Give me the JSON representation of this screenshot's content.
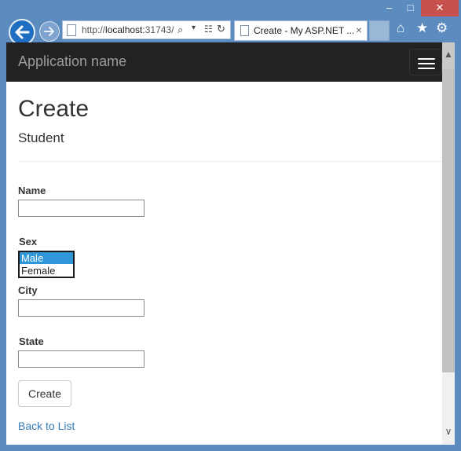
{
  "window": {
    "minimize_glyph": "–",
    "maximize_glyph": "□",
    "close_glyph": "✕"
  },
  "browser": {
    "address_prefix": "http://",
    "address_host": "localhost",
    "address_rest": ":31743/",
    "tab_title": "Create - My ASP.NET ...",
    "tab_close_glyph": "×",
    "icons": [
      "back-arrow-icon",
      "forward-arrow-icon",
      "page-icon",
      "search-icon",
      "dropdown-icon",
      "compatibility-icon",
      "refresh-icon",
      "home-icon",
      "star-icon",
      "gear-icon"
    ]
  },
  "navbar": {
    "brand": "Application name",
    "toggle_icon": "hamburger-icon"
  },
  "page": {
    "title": "Create",
    "subtitle": "Student"
  },
  "form": {
    "name_label": "Name",
    "name_value": "",
    "sex_label": "Sex",
    "sex_options": [
      "Male",
      "Female"
    ],
    "sex_selected": "Male",
    "city_label": "City",
    "city_value": "",
    "state_label": "State",
    "state_value": "",
    "submit_label": "Create",
    "back_link": "Back to List"
  },
  "colors": {
    "navbar_bg": "#222222",
    "link": "#337ab7",
    "selected_option": "#2e96d9",
    "close_button": "#c7514d"
  }
}
